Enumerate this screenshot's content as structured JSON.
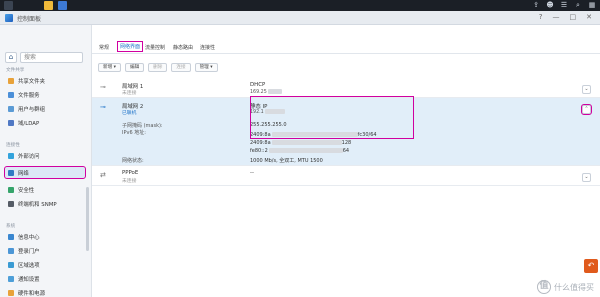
{
  "window": {
    "title": "控制面板"
  },
  "sidebar": {
    "search_placeholder": "搜索",
    "sections": [
      {
        "label": "文件共享",
        "items": [
          {
            "label": "共享文件夹",
            "color": "#e8a23a"
          },
          {
            "label": "文件服务",
            "color": "#4b8fd8"
          },
          {
            "label": "用户与群组",
            "color": "#5b9bd5"
          },
          {
            "label": "域/LDAP",
            "color": "#4f78c4"
          }
        ]
      },
      {
        "label": "连接性",
        "items": [
          {
            "label": "外部访问",
            "color": "#33a3dc"
          },
          {
            "label": "网络",
            "color": "#2f7ac4",
            "active": true
          },
          {
            "label": "安全性",
            "color": "#35a46b"
          },
          {
            "label": "终端机和 SNMP",
            "color": "#555c66"
          }
        ]
      },
      {
        "label": "系统",
        "items": [
          {
            "label": "信息中心",
            "color": "#3a87d0"
          },
          {
            "label": "登录门户",
            "color": "#4b96d6"
          },
          {
            "label": "区域选项",
            "color": "#3a9bd3"
          },
          {
            "label": "通知设置",
            "color": "#4e9fd8"
          },
          {
            "label": "硬件和电源",
            "color": "#e8a23a"
          }
        ]
      }
    ]
  },
  "main": {
    "tabs": [
      "常规",
      "网络界面",
      "流量控制",
      "静态路由",
      "连接性"
    ],
    "active_tab": 1,
    "toolbar": [
      "新增 ▾",
      "编辑",
      "删除",
      "连接",
      "管理 ▾"
    ],
    "interfaces": [
      {
        "name": "局域网 1",
        "status": "未连接",
        "mode": "DHCP",
        "ip": "169.25"
      },
      {
        "name": "局域网 2",
        "status": "已联机",
        "mode": "静态 IP",
        "ip": "192.1"
      },
      {
        "name": "PPPoE",
        "status": "未连接",
        "mode": "--",
        "ip": ""
      }
    ],
    "details": {
      "subnet_label": "子网掩码 (mask):",
      "subnet_value": "255.255.255.0",
      "ipv6_label": "IPv6 地址:",
      "ipv6_values": [
        "2409:8a",
        "2409:8a",
        "fe80::2"
      ],
      "ipv6_suffixes": [
        "fc30/64",
        "128",
        "64"
      ],
      "status_label": "网络状态:",
      "status_value": "1000 Mb/s, 全双工, MTU 1500"
    }
  },
  "watermark": {
    "text": "什么值得买",
    "logo": "值"
  }
}
